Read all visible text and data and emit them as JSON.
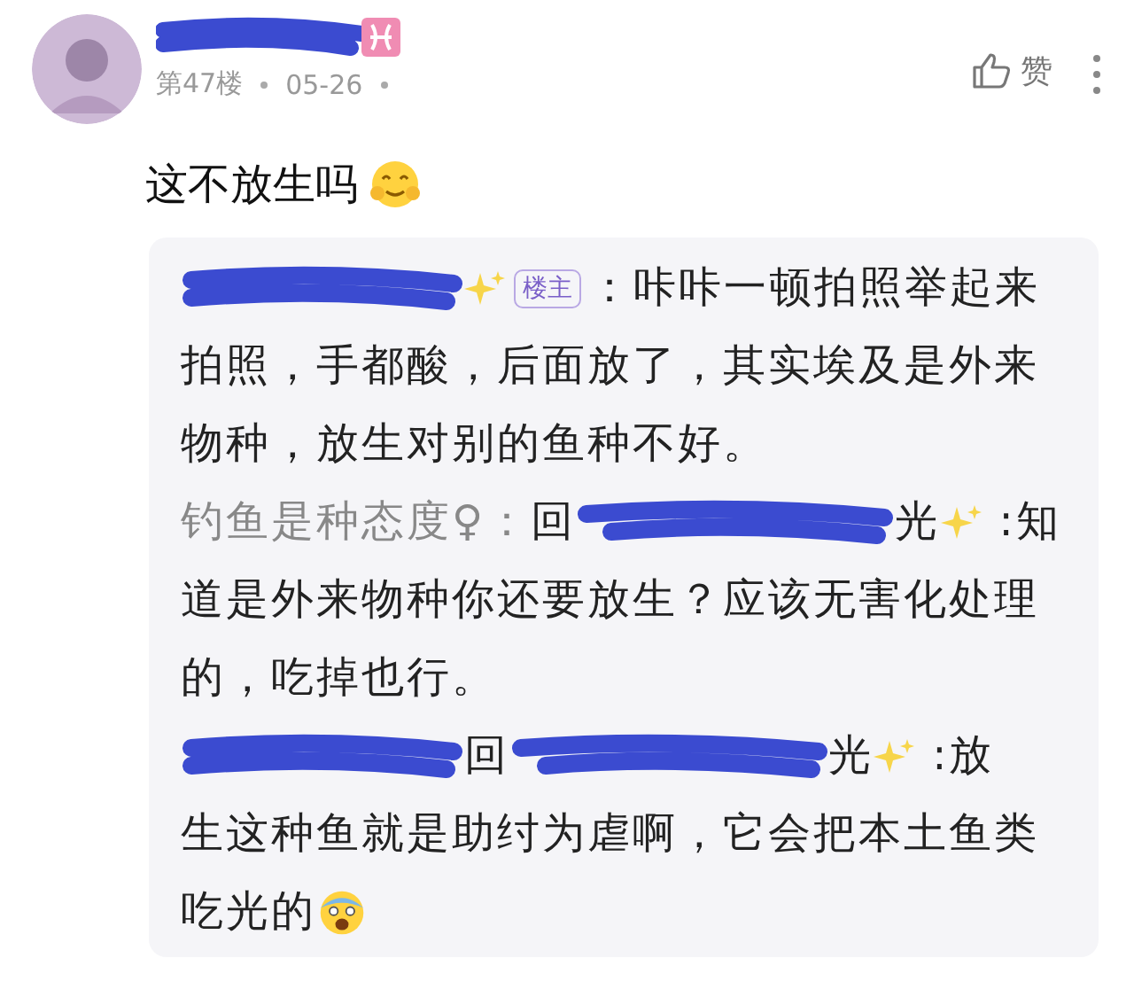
{
  "post": {
    "name_redacted": true,
    "floor": "第47楼",
    "date": "05-26",
    "like_label": "赞",
    "content": "这不放生吗"
  },
  "replies": [
    {
      "author_redacted": true,
      "badge": "楼主",
      "text_lines": [
        "：咔咔一顿拍照举起来",
        "拍照，手都酸，后面放了，其实埃及是外来",
        "物种，放生对别的鱼种不好。"
      ]
    },
    {
      "author": "钓鱼是种态度♀：",
      "reply_prefix": "回",
      "reply_redacted": true,
      "reply_suffix": "光",
      "text_lines": [
        " :知",
        "道是外来物种你还要放生？应该无害化处理",
        "的，吃掉也行。"
      ]
    },
    {
      "author_redacted": true,
      "reply_prefix": "回",
      "reply_redacted": true,
      "reply_suffix": "光",
      "text_lines": [
        " :放",
        "生这种鱼就是助纣为虐啊，它会把本土鱼类",
        "吃光的"
      ],
      "emoji": true
    }
  ]
}
